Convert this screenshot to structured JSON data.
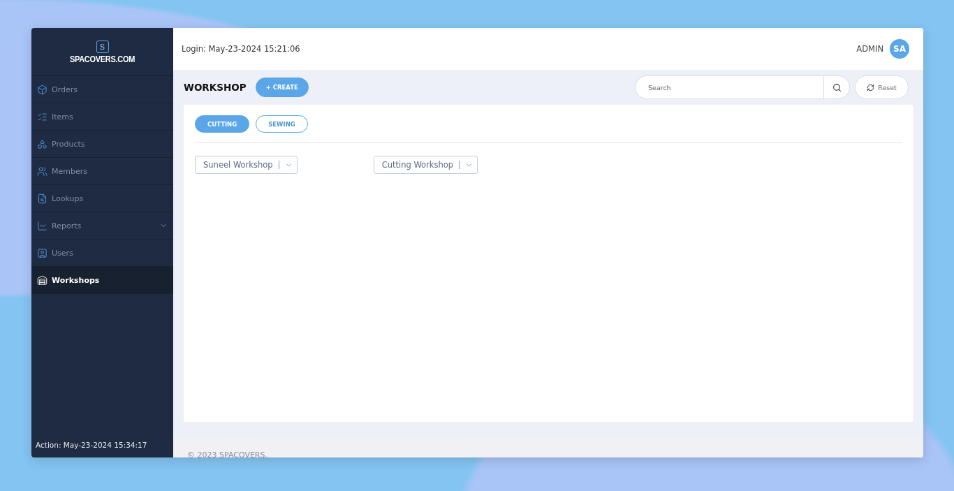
{
  "brand": {
    "name": "SPACOVERS.COM",
    "mark": "S"
  },
  "sidebar": {
    "items": [
      {
        "label": "Orders",
        "selected": false,
        "expandable": false
      },
      {
        "label": "Items",
        "selected": false,
        "expandable": false
      },
      {
        "label": "Products",
        "selected": false,
        "expandable": false
      },
      {
        "label": "Members",
        "selected": false,
        "expandable": false
      },
      {
        "label": "Lookups",
        "selected": false,
        "expandable": false
      },
      {
        "label": "Reports",
        "selected": false,
        "expandable": true
      },
      {
        "label": "Users",
        "selected": false,
        "expandable": false
      },
      {
        "label": "Workshops",
        "selected": true,
        "expandable": false
      }
    ],
    "action": "Action: May-23-2024 15:34:17"
  },
  "header": {
    "login": "Login: May-23-2024 15:21:06",
    "role": "ADMIN",
    "avatar": "SA"
  },
  "page": {
    "title": "WORKSHOP",
    "create": "+ CREATE",
    "search": {
      "placeholder": "Search"
    },
    "reset": "Reset"
  },
  "tabs": [
    {
      "label": "CUTTING",
      "selected": true
    },
    {
      "label": "SEWING",
      "selected": false
    }
  ],
  "selects": [
    {
      "value": "Suneel Workshop"
    },
    {
      "value": "Cutting Workshop"
    }
  ],
  "footer": "© 2023 SPACOVERS."
}
